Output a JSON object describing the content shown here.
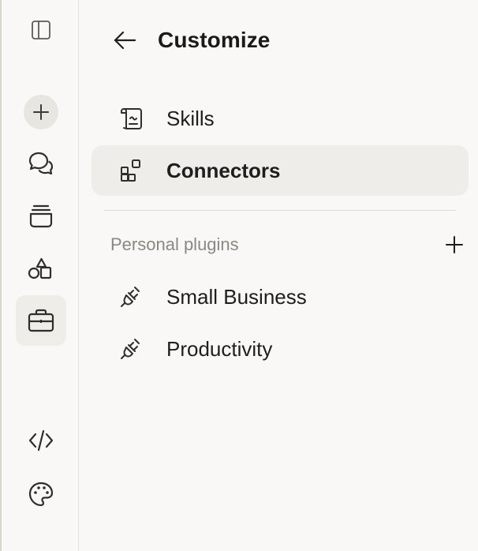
{
  "header": {
    "title": "Customize",
    "back_icon": "arrow-left-icon"
  },
  "rail": {
    "items": [
      {
        "icon": "sidebar-toggle-icon"
      },
      {
        "icon": "plus-icon"
      },
      {
        "icon": "chats-icon"
      },
      {
        "icon": "projects-icon"
      },
      {
        "icon": "artifacts-icon"
      },
      {
        "icon": "briefcase-icon",
        "active": true
      },
      {
        "icon": "code-icon"
      },
      {
        "icon": "palette-icon"
      }
    ]
  },
  "nav": {
    "items": [
      {
        "label": "Skills",
        "icon": "scroll-icon"
      },
      {
        "label": "Connectors",
        "icon": "connectors-icon",
        "active": true
      }
    ]
  },
  "plugins": {
    "section_title": "Personal plugins",
    "add_icon": "plus-icon",
    "items": [
      {
        "label": "Small Business",
        "icon": "plug-icon"
      },
      {
        "label": "Productivity",
        "icon": "plug-icon"
      }
    ]
  },
  "colors": {
    "background": "#f9f8f6",
    "active_bg": "#efede9",
    "muted_text": "#8a8883",
    "text": "#1f1e1d"
  }
}
